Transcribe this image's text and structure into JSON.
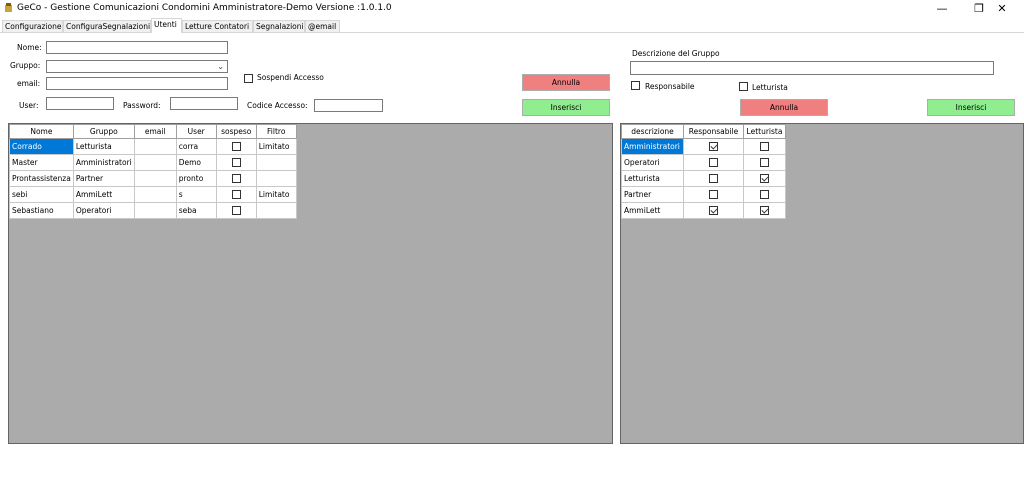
{
  "window": {
    "title": "GeCo - Gestione Comunicazioni Condomini Amministratore-Demo  Versione :1.0.1.0",
    "minimize": "—",
    "restore": "❐",
    "close": "✕"
  },
  "tabs": [
    {
      "label": "Configurazione"
    },
    {
      "label": "ConfiguraSegnalazioni"
    },
    {
      "label": "Utenti"
    },
    {
      "label": "Letture Contatori"
    },
    {
      "label": "Segnalazioni"
    },
    {
      "label": "@email"
    }
  ],
  "active_tab": "Utenti",
  "user_form": {
    "nome_label": "Nome:",
    "nome_value": "",
    "gruppo_label": "Gruppo:",
    "gruppo_value": "",
    "email_label": "email:",
    "email_value": "",
    "sospendi_label": "Sospendi Accesso",
    "sospendi_checked": false,
    "user_label": "User:",
    "user_value": "",
    "password_label": "Password:",
    "password_value": "",
    "codice_label": "Codice Accesso:",
    "codice_value": "",
    "annulla_label": "Annulla",
    "inserisci_label": "Inserisci"
  },
  "group_form": {
    "descrizione_label": "Descrizione del Gruppo",
    "descrizione_value": "",
    "responsabile_label": "Responsabile",
    "responsabile_checked": false,
    "letturista_label": "Letturista",
    "letturista_checked": false,
    "annulla_label": "Annulla",
    "inserisci_label": "Inserisci"
  },
  "users_table": {
    "columns": [
      "Nome",
      "Gruppo",
      "email",
      "User",
      "sospeso",
      "Filtro"
    ],
    "rows": [
      {
        "nome": "Corrado",
        "gruppo": "Letturista",
        "email": "",
        "user": "corra",
        "sospeso": false,
        "filtro": "Limitato"
      },
      {
        "nome": "Master",
        "gruppo": "Amministratori",
        "email": "",
        "user": "Demo",
        "sospeso": false,
        "filtro": ""
      },
      {
        "nome": "Prontassistenza",
        "gruppo": "Partner",
        "email": "",
        "user": "pronto",
        "sospeso": false,
        "filtro": ""
      },
      {
        "nome": "sebi",
        "gruppo": "AmmiLett",
        "email": "",
        "user": "s",
        "sospeso": false,
        "filtro": "Limitato"
      },
      {
        "nome": "Sebastiano",
        "gruppo": "Operatori",
        "email": "",
        "user": "seba",
        "sospeso": false,
        "filtro": ""
      }
    ]
  },
  "groups_table": {
    "columns": [
      "descrizione",
      "Responsabile",
      "Letturista"
    ],
    "rows": [
      {
        "descrizione": "Amministratori",
        "responsabile": true,
        "letturista": false
      },
      {
        "descrizione": "Operatori",
        "responsabile": false,
        "letturista": false
      },
      {
        "descrizione": "Letturista",
        "responsabile": false,
        "letturista": true
      },
      {
        "descrizione": "Partner",
        "responsabile": false,
        "letturista": false
      },
      {
        "descrizione": "AmmiLett",
        "responsabile": true,
        "letturista": true
      }
    ]
  },
  "colors": {
    "grid_background": "#ababab",
    "selection": "#0078d7",
    "annulla_button": "#f08080",
    "inserisci_button": "#90ee90"
  }
}
